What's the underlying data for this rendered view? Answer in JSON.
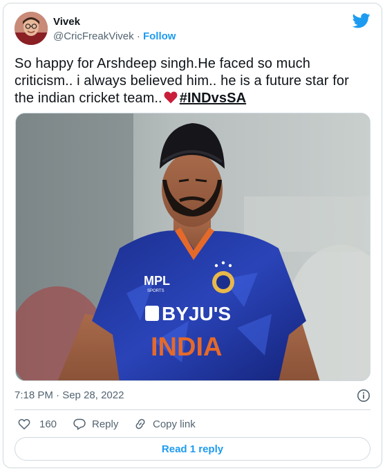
{
  "user": {
    "display_name": "Vivek",
    "handle": "@CricFreakVivek",
    "separator": "·",
    "follow_label": "Follow"
  },
  "tweet": {
    "text": "So happy for Arshdeep singh.He faced so much criticism.. i always believed him.. he is a future star for the indian cricket team..",
    "emoji": "heart-emoji",
    "hashtag": "#INDvsSA"
  },
  "media": {
    "jersey_brand": "BYJU'S",
    "jersey_country": "INDIA",
    "jersey_sponsor": "MPL",
    "jersey_sponsor_sub": "SPORTS"
  },
  "meta": {
    "timestamp": "7:18 PM · Sep 28, 2022"
  },
  "actions": {
    "like_count": "160",
    "reply_label": "Reply",
    "copy_label": "Copy link"
  },
  "footer": {
    "read_replies_label": "Read 1 reply"
  },
  "colors": {
    "accent": "#1d9bf0",
    "secondary_text": "#536471",
    "border": "#cfd9de"
  }
}
